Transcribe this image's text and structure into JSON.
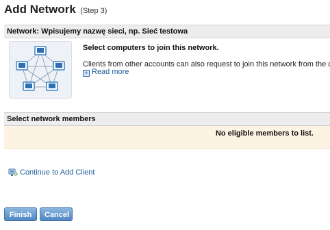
{
  "page": {
    "title": "Add Network",
    "step": "(Step 3)"
  },
  "network_bar": {
    "label": "Network: Wpisujemy nazwę sieci, np. Sieć testowa"
  },
  "info": {
    "heading": "Select computers to join this network.",
    "description": "Clients from other accounts can also request to join this network from the client i",
    "read_more": "Read more"
  },
  "members": {
    "header": "Select network members",
    "empty_message": "No eligible members to list."
  },
  "actions": {
    "continue_link": "Continue to Add Client",
    "finish": "Finish",
    "cancel": "Cancel"
  },
  "colors": {
    "link": "#1d5d9b",
    "button": "#5a8fcb",
    "members_bg": "#fdf3e2",
    "bar_bg": "#ededed"
  },
  "icons": [
    "network-diagram-icon",
    "plus-box-icon",
    "add-client-icon"
  ]
}
